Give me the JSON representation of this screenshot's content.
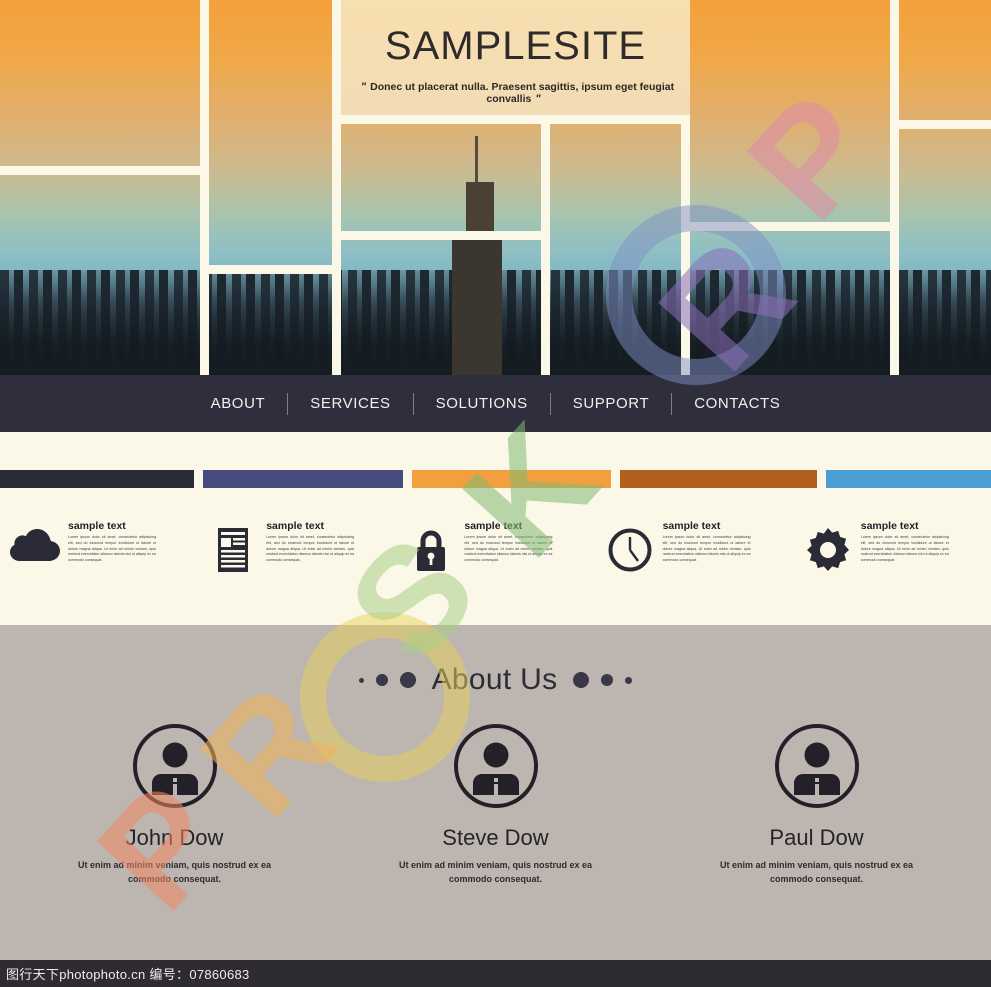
{
  "hero": {
    "site_title": "SAMPLESITE",
    "quote_mark": "\"",
    "tagline": "Donec ut placerat nulla. Praesent sagittis, ipsum eget feugiat convallis"
  },
  "nav": {
    "items": [
      {
        "label": "ABOUT"
      },
      {
        "label": "SERVICES"
      },
      {
        "label": "SOLUTIONS"
      },
      {
        "label": "SUPPORT"
      },
      {
        "label": "CONTACTS"
      }
    ]
  },
  "features": {
    "bar_colors": [
      "#2b2b38",
      "#474b7f",
      "#f2a03f",
      "#b1601d",
      "#4b9ed4"
    ],
    "items": [
      {
        "icon": "cloud-icon",
        "heading": "sample text",
        "body": "Lorem ipsum dolor sit amet, consectetur adipisicing elit, sed do eiusmod tempor incididunt ut labore et dolore magna aliqua. Ut enim ad minim veniam, quis nostrud exercitation ullamco laboris nisi ut aliquip ex ea commodo consequat."
      },
      {
        "icon": "document-icon",
        "heading": "sample text",
        "body": "Lorem ipsum dolor sit amet, consectetur adipisicing elit, sed do eiusmod tempor incididunt ut labore et dolore magna aliqua. Ut enim ad minim veniam, quis nostrud exercitation ullamco laboris nisi ut aliquip ex ea commodo consequat."
      },
      {
        "icon": "lock-icon",
        "heading": "sample text",
        "body": "Lorem ipsum dolor sit amet, consectetur adipisicing elit, sed do eiusmod tempor incididunt ut labore et dolore magna aliqua. Ut enim ad minim veniam, quis nostrud exercitation ullamco laboris nisi ut aliquip ex ea commodo consequat."
      },
      {
        "icon": "clock-icon",
        "heading": "sample text",
        "body": "Lorem ipsum dolor sit amet, consectetur adipisicing elit, sed do eiusmod tempor incididunt ut labore et dolore magna aliqua. Ut enim ad minim veniam, quis nostrud exercitation ullamco laboris nisi ut aliquip ex ea commodo consequat."
      },
      {
        "icon": "gear-icon",
        "heading": "sample text",
        "body": "Lorem ipsum dolor sit amet, consectetur adipisicing elit, sed do eiusmod tempor incididunt ut labore et dolore magna aliqua. Ut enim ad minim veniam, quis nostrud exercitation ullamco laboris nisi ut aliquip ex ea commodo consequat."
      }
    ]
  },
  "about": {
    "title": "About Us",
    "members": [
      {
        "name": "John Dow",
        "bio": "Ut enim ad minim veniam, quis nostrud ex ea commodo consequat.",
        "avatar": "person-info-avatar"
      },
      {
        "name": "Steve Dow",
        "bio": "Ut enim ad minim veniam, quis nostrud ex ea commodo consequat.",
        "avatar": "person-info-avatar"
      },
      {
        "name": "Paul Dow",
        "bio": "Ut enim ad minim veniam, quis nostrud ex ea commodo consequat.",
        "avatar": "person-info-avatar"
      }
    ]
  },
  "watermark": {
    "text": "PROSKORP",
    "letters": [
      "P",
      "R",
      "O",
      "S",
      "K",
      "O",
      "R",
      "P"
    ]
  },
  "footer": {
    "text": "图行天下photophoto.cn  编号：07860683"
  },
  "colors": {
    "nav_bg": "#2e2e3c",
    "features_bg": "#fcf8e8",
    "about_bg": "#bdb5af",
    "footer_bg": "#2f2b33",
    "title_panel": "#f4ddb2"
  }
}
